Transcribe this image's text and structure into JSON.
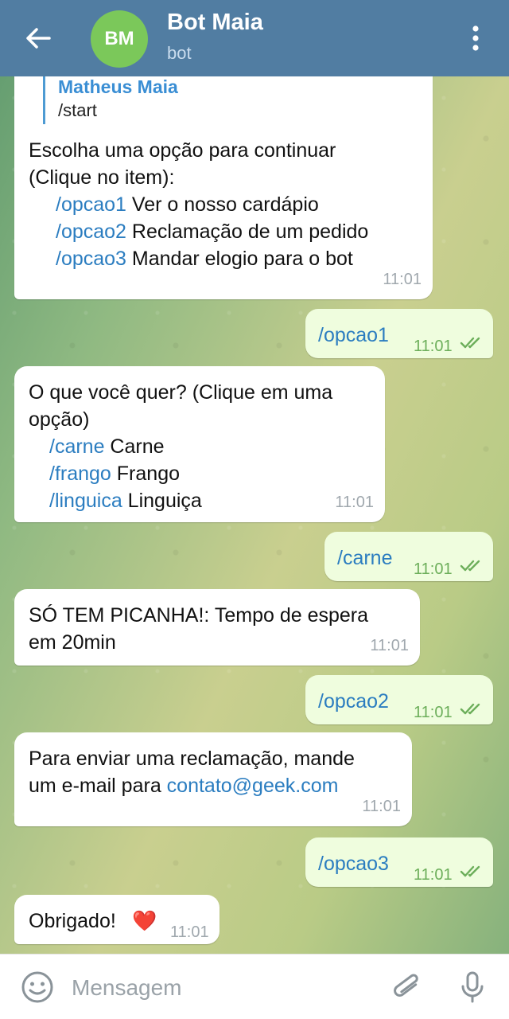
{
  "header": {
    "back_icon": "arrow-left-icon",
    "avatar_initials": "BM",
    "avatar_color": "#7bc85a",
    "title": "Bot Maia",
    "subtitle": "bot",
    "menu_icon": "more-vertical-icon",
    "bar_color": "#517da2"
  },
  "messages": [
    {
      "direction": "incoming",
      "reply_to": {
        "name": "Matheus Maia",
        "text": "/start"
      },
      "lines": [
        "Escolha uma opção para continuar",
        "(Clique no item):"
      ],
      "options": [
        {
          "cmd": "/opcao1",
          "text": " Ver o nosso cardápio"
        },
        {
          "cmd": "/opcao2",
          "text": " Reclamação de um pedido"
        },
        {
          "cmd": "/opcao3",
          "text": " Mandar elogio para o bot"
        }
      ],
      "time": "11:01"
    },
    {
      "direction": "outgoing",
      "text": "/opcao1",
      "time": "11:01",
      "status": "read"
    },
    {
      "direction": "incoming",
      "lines": [
        "O que você quer? (Clique em uma",
        "opção)"
      ],
      "options": [
        {
          "cmd": "/carne",
          "text": " Carne"
        },
        {
          "cmd": "/frango",
          "text": " Frango"
        },
        {
          "cmd": "/linguica",
          "text": " Linguiça"
        }
      ],
      "time": "11:01"
    },
    {
      "direction": "outgoing",
      "text": "/carne",
      "time": "11:01",
      "status": "read"
    },
    {
      "direction": "incoming",
      "lines": [
        "SÓ TEM PICANHA!: Tempo de espera",
        "em 20min"
      ],
      "time": "11:01"
    },
    {
      "direction": "outgoing",
      "text": "/opcao2",
      "time": "11:01",
      "status": "read"
    },
    {
      "direction": "incoming",
      "lines": [
        "Para enviar uma reclamação, mande"
      ],
      "line2_prefix": "um e-mail para ",
      "link": "contato@geek.com",
      "time": "11:01"
    },
    {
      "direction": "outgoing",
      "text": "/opcao3",
      "time": "11:01",
      "status": "read"
    },
    {
      "direction": "incoming",
      "text": "Obrigado! ",
      "emoji": "❤️",
      "time": "11:01"
    }
  ],
  "input": {
    "placeholder": "Mensagem",
    "value": "",
    "emoji_icon": "emoji-smile-icon",
    "attach_icon": "paperclip-icon",
    "mic_icon": "microphone-icon"
  },
  "colors": {
    "incoming_bubble": "#ffffff",
    "outgoing_bubble": "#effdde",
    "link": "#2b7dc0",
    "check_color": "#6cae5a"
  }
}
